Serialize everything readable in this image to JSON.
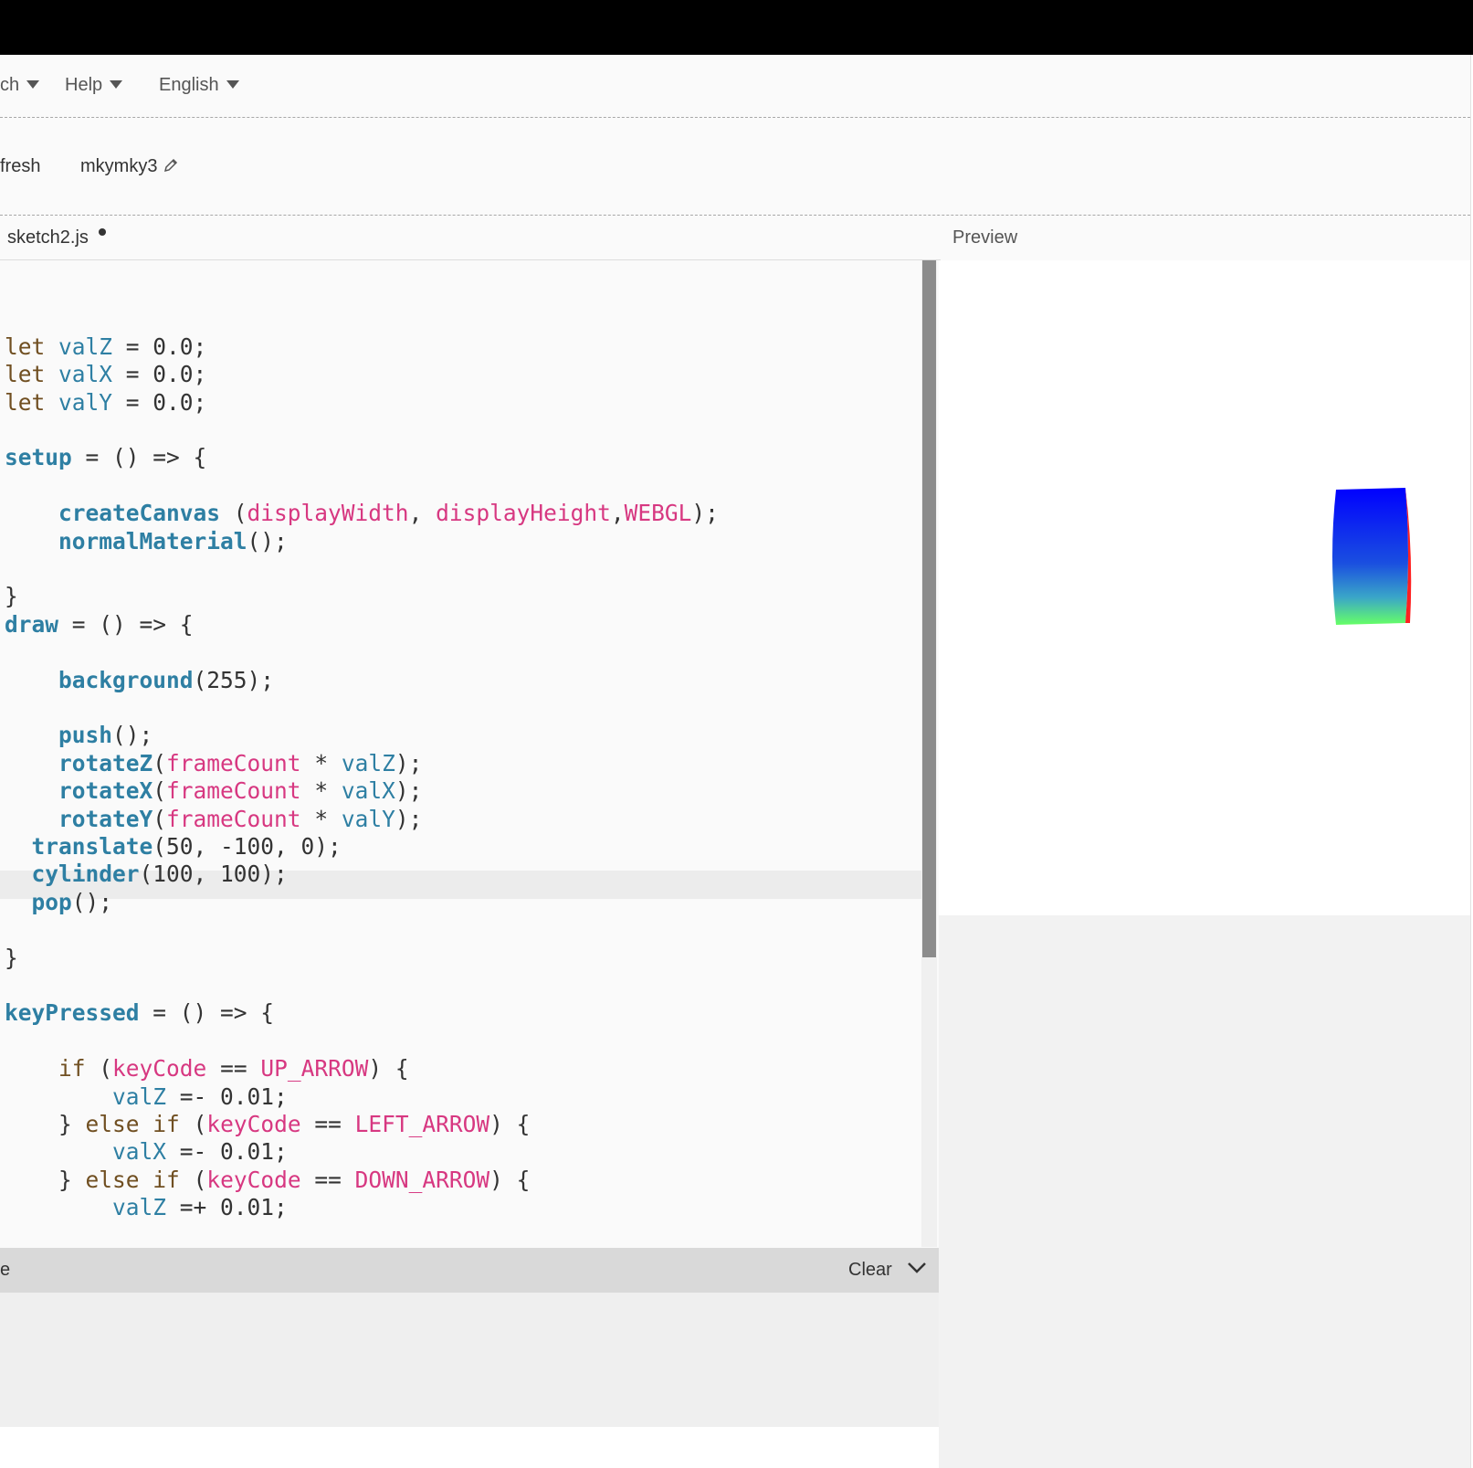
{
  "menubar": {
    "items": [
      {
        "label": "ch"
      },
      {
        "label": "Help"
      },
      {
        "label": "English"
      }
    ]
  },
  "toolbar": {
    "refresh_label": "fresh",
    "sketch_name": "mkymky3"
  },
  "editor": {
    "file_tab": "sketch2.js",
    "active_line": 21,
    "lines": [
      "",
      "",
      "let valZ = 0.0;",
      "let valX = 0.0;",
      "let valY = 0.0;",
      "",
      "setup = () => {",
      "",
      "    createCanvas (displayWidth, displayHeight,WEBGL);",
      "    normalMaterial();",
      "",
      "}",
      "draw = () => {",
      "",
      "    background(255);",
      "",
      "    push();",
      "    rotateZ(frameCount * valZ);",
      "    rotateX(frameCount * valX);",
      "    rotateY(frameCount * valY);",
      "  translate(50, -100, 0);",
      "  cylinder(100, 100);",
      "  pop();",
      "",
      "}",
      "",
      "keyPressed = () => {",
      "",
      "    if (keyCode == UP_ARROW) {",
      "        valZ =- 0.01;",
      "    } else if (keyCode == LEFT_ARROW) {",
      "        valX =- 0.01;",
      "    } else if (keyCode == DOWN_ARROW) {",
      "        valZ =+ 0.01;"
    ]
  },
  "preview": {
    "label": "Preview"
  },
  "console": {
    "title_fragment": "e",
    "clear_label": "Clear"
  },
  "icons": {
    "menu_caret": "caret-down-icon",
    "edit": "pencil-icon",
    "collapse": "chevron-down-icon"
  },
  "colors": {
    "keyword": "#704f21",
    "variable": "#2e7fa3",
    "function": "#2e7fa3",
    "p5_symbol": "#d73881",
    "cylinder_top": "#0000ff",
    "cylinder_bottom": "#66ff66",
    "cylinder_rim": "#ff2020"
  }
}
